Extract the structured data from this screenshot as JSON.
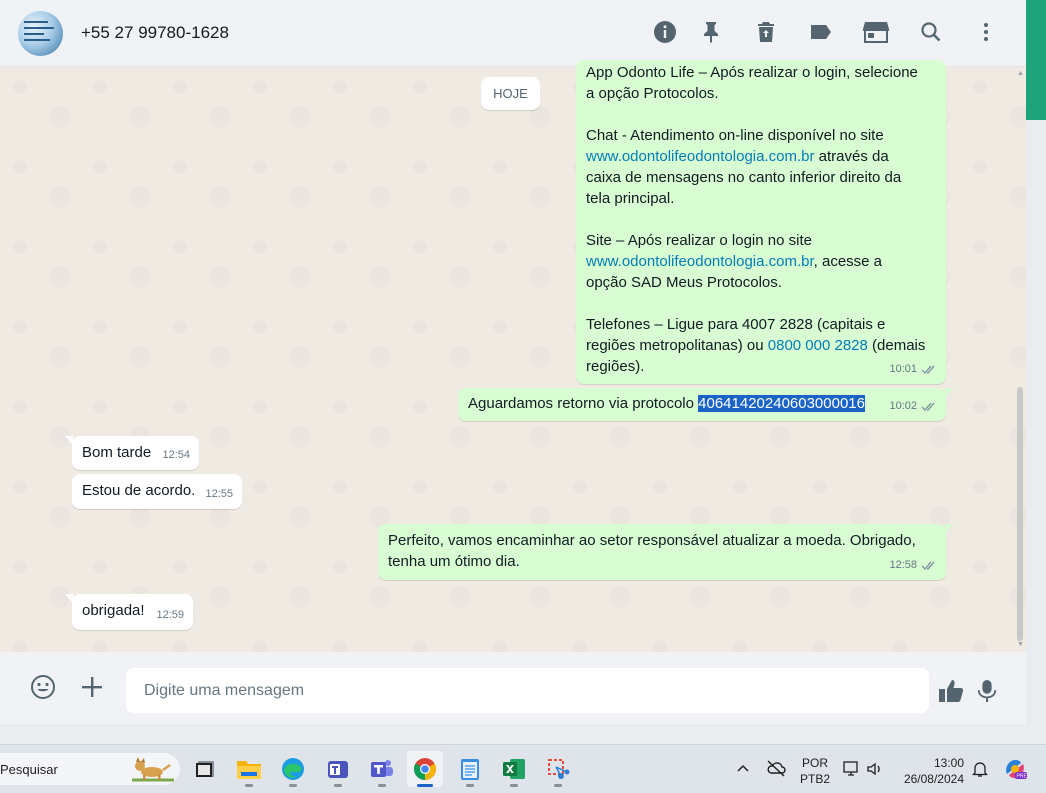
{
  "header": {
    "contact_name": "+55 27 99780-1628",
    "icons": [
      "info-icon",
      "pin-icon",
      "delete-icon",
      "label-icon",
      "catalog-icon",
      "search-icon",
      "more-options-icon"
    ]
  },
  "chat": {
    "date_chip": "HOJE",
    "messages": [
      {
        "direction": "out",
        "line1": "App Odonto Life – Após realizar o login, selecione",
        "line2": "a opção Protocolos.",
        "chat_label": "Chat - Atendimento on-line disponível no site",
        "link1": "www.odontolifeodontologia.com.br",
        "after_link1": " através da",
        "chat_rest": "caixa de mensagens no canto inferior direito da\ntela principal.",
        "site_label": "Site – Após realizar o login no site",
        "link2": "www.odontolifeodontologia.com.br",
        "after_link2": ", acesse a",
        "site_rest": "opção SAD Meus Protocolos.",
        "phone_line1": "Telefones – Ligue para 4007 2828 (capitais e",
        "phone_line2a": "regiões metropolitanas) ou ",
        "phone_link": "0800 000 2828",
        "phone_line2b": " (demais",
        "phone_line3": "regiões).",
        "time": "10:01",
        "status": "read"
      },
      {
        "direction": "out",
        "text": "Aguardamos retorno via protocolo ",
        "selected_text": "40641420240603000016",
        "time": "10:02",
        "status": "read"
      },
      {
        "direction": "in",
        "text": "Bom tarde",
        "time": "12:54"
      },
      {
        "direction": "in",
        "text": "Estou de acordo.",
        "time": "12:55"
      },
      {
        "direction": "out",
        "text": "Perfeito, vamos encaminhar ao setor responsável atualizar a moeda. Obrigado,\ntenha um ótimo dia.",
        "time": "12:58",
        "status": "read"
      },
      {
        "direction": "in",
        "text": "obrigada!",
        "time": "12:59"
      }
    ]
  },
  "composer": {
    "placeholder": "Digite uma mensagem",
    "icons": [
      "emoji-icon",
      "attach-plus-icon",
      "sticker-thumbs-up-icon",
      "microphone-icon"
    ]
  },
  "taskbar": {
    "search_placeholder": "Pesquisar",
    "apps": [
      "task-view",
      "file-explorer",
      "edge",
      "teams-work",
      "teams",
      "chrome",
      "notepad",
      "excel",
      "snipping-tool"
    ],
    "active_app": "chrome",
    "language_line1": "POR",
    "language_line2": "PTB2",
    "time": "13:00",
    "date": "26/08/2024"
  },
  "colors": {
    "outgoing_bubble": "#d9fdd3",
    "incoming_bubble": "#ffffff",
    "chat_background": "#efeae2",
    "link": "#027eb5",
    "selection": "#1a64c7",
    "accent_green": "#1ea37a"
  }
}
